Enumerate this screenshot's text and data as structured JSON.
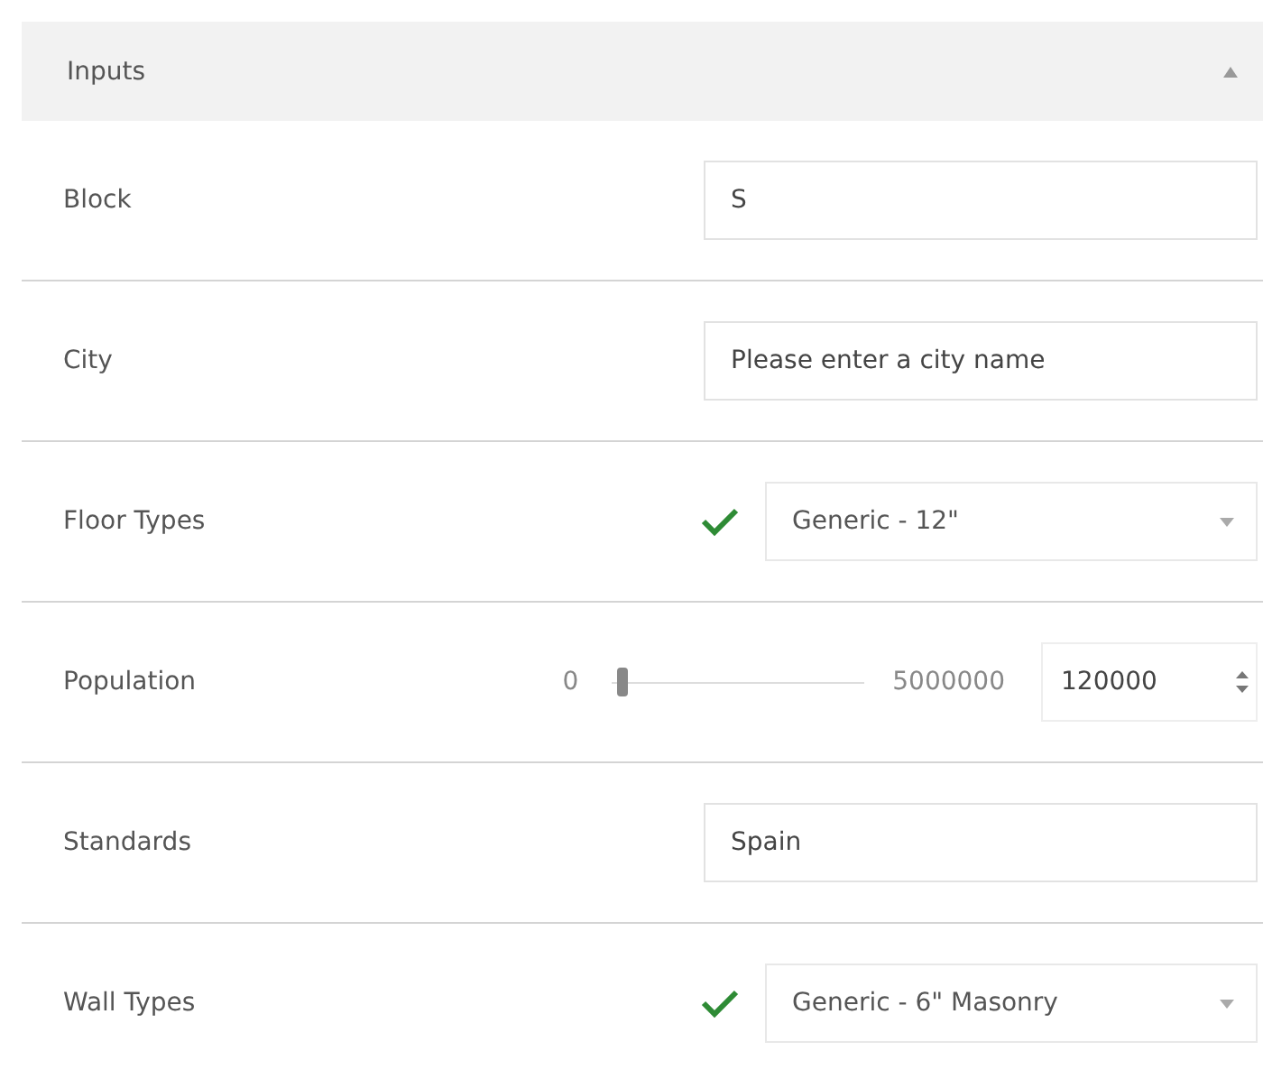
{
  "panel": {
    "title": "Inputs",
    "expanded": true
  },
  "inputs": [
    {
      "kind": "text",
      "label": "Block",
      "value": "S"
    },
    {
      "kind": "text",
      "label": "City",
      "placeholder": "Please enter a city name"
    },
    {
      "kind": "dropdown",
      "label": "Floor Types",
      "valid": true,
      "value": "Generic - 12\""
    },
    {
      "kind": "slider",
      "label": "Population",
      "min": "0",
      "max": "5000000",
      "level": 0.024,
      "value": "120000"
    },
    {
      "kind": "text",
      "label": "Standards",
      "value": "Spain"
    },
    {
      "kind": "dropdown",
      "label": "Wall Types",
      "valid": true,
      "value": "Generic - 6\" Masonry"
    }
  ]
}
